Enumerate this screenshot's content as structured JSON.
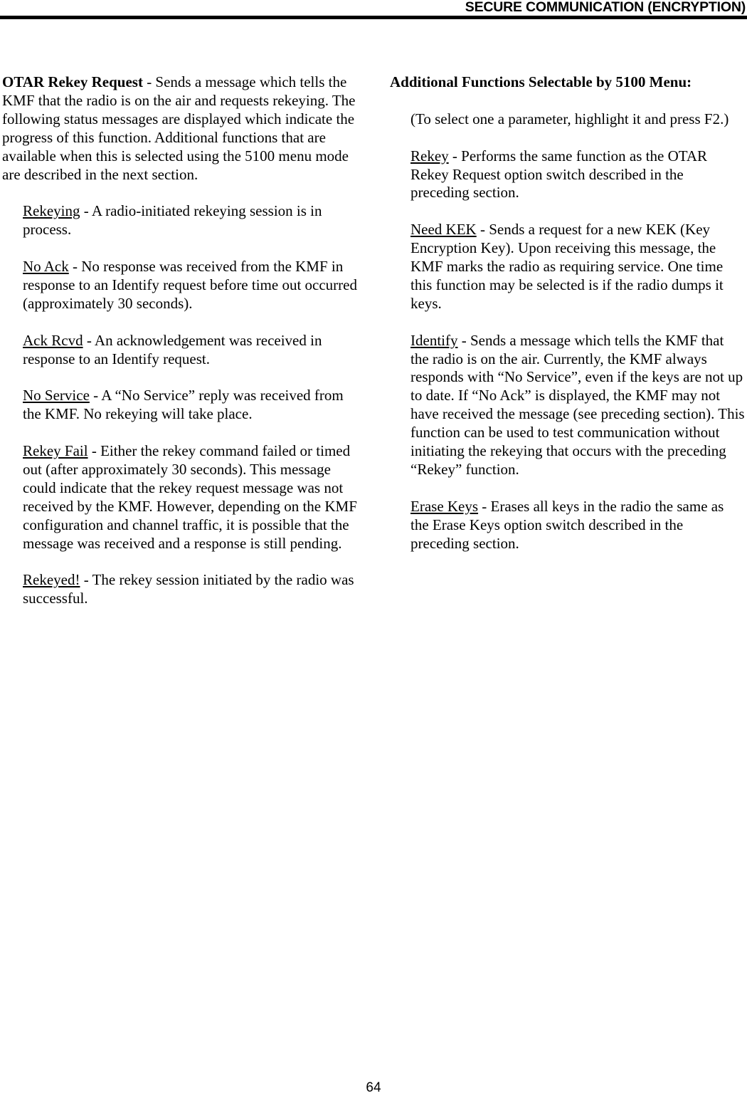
{
  "header": {
    "title": "SECURE COMMUNICATION (ENCRYPTION)"
  },
  "left_column": {
    "intro": {
      "lead": "OTAR Rekey Request",
      "body": " - Sends a message which tells the KMF that the radio is on the air and requests rekeying. The following status messages are displayed which indicate the progress of this function. Additional functions that are available when this is selected using the 5100 menu mode are described in the next section."
    },
    "status_messages": [
      {
        "term": "Rekeying",
        "body": " - A radio-initiated rekeying session is in process."
      },
      {
        "term": "No Ack",
        "body": " - No response was received from the KMF in response to an Identify request before time out occurred (approximately 30 seconds)."
      },
      {
        "term": "Ack Rcvd",
        "body": " - An acknowledgement was received in response to an Identify request."
      },
      {
        "term": "No Service",
        "body": " - A “No Service” reply was received from the KMF. No rekeying will take place."
      },
      {
        "term": "Rekey Fail",
        "body": " - Either the rekey command failed or timed out (after approximately 30 seconds). This message could indicate that the rekey request message was not received by the KMF. However, depending on the KMF configuration and channel traffic, it is possible that the message was received and a response is still pending."
      },
      {
        "term": "Rekeyed!",
        "body": " - The rekey session initiated by the radio was successful."
      }
    ]
  },
  "right_column": {
    "heading": "Additional Functions Selectable by 5100 Menu:",
    "note": "(To select one a parameter, highlight it and press F2.)",
    "functions": [
      {
        "term": "Rekey",
        "body": " - Performs the same function as the OTAR Rekey Request option switch described in the preceding section."
      },
      {
        "term": "Need KEK",
        "body": " - Sends a request for a new KEK (Key Encryption Key). Upon receiving this message, the KMF marks the radio as requiring service. One time this function may be selected is if the radio dumps it keys."
      },
      {
        "term": "Identify",
        "body": " - Sends a message which tells the KMF that the radio is on the air. Currently, the KMF always responds with “No Service”, even if the keys are not up to date. If “No Ack” is displayed, the KMF may not have received the message (see preceding section). This function can be used to test communication without initiating the rekeying that occurs with the preceding “Rekey” function."
      },
      {
        "term": "Erase Keys",
        "body": " - Erases all keys in the radio the same as the Erase Keys option switch described in the preceding section."
      }
    ]
  },
  "footer": {
    "page_number": "64"
  }
}
